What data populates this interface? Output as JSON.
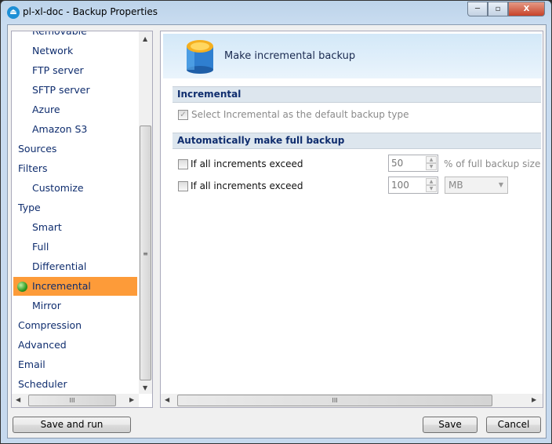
{
  "window": {
    "title": "pl-xl-doc - Backup Properties",
    "minimize": "─",
    "maximize": "▫",
    "close": "X"
  },
  "sidebar": {
    "items": [
      {
        "label": "Removable",
        "level": 2
      },
      {
        "label": "Network",
        "level": 2
      },
      {
        "label": "FTP server",
        "level": 2
      },
      {
        "label": "SFTP server",
        "level": 2
      },
      {
        "label": "Azure",
        "level": 2
      },
      {
        "label": "Amazon S3",
        "level": 2
      },
      {
        "label": "Sources",
        "level": 1
      },
      {
        "label": "Filters",
        "level": 1
      },
      {
        "label": "Customize",
        "level": 2
      },
      {
        "label": "Type",
        "level": 1
      },
      {
        "label": "Smart",
        "level": 2
      },
      {
        "label": "Full",
        "level": 2
      },
      {
        "label": "Differential",
        "level": 2
      },
      {
        "label": "Incremental",
        "level": 2,
        "selected": true
      },
      {
        "label": "Mirror",
        "level": 2
      },
      {
        "label": "Compression",
        "level": 1
      },
      {
        "label": "Advanced",
        "level": 1
      },
      {
        "label": "Email",
        "level": 1
      },
      {
        "label": "Scheduler",
        "level": 1
      }
    ],
    "selected_color": "#fd9b39"
  },
  "main": {
    "header": "Make incremental backup",
    "section1": {
      "title": "Incremental",
      "option": "Select Incremental as the default backup type",
      "checked": true,
      "disabled": true
    },
    "section2": {
      "title": "Automatically make full backup",
      "row1": {
        "label": "If all increments exceed",
        "value": "50",
        "unit": "% of full backup size",
        "checked": false
      },
      "row2": {
        "label": "If all increments exceed",
        "value": "100",
        "unit": "MB",
        "checked": false
      }
    }
  },
  "buttons": {
    "save_and_run": "Save and run",
    "save": "Save",
    "cancel": "Cancel"
  },
  "scroll": {
    "grip": "III",
    "v_grip": "≡"
  }
}
